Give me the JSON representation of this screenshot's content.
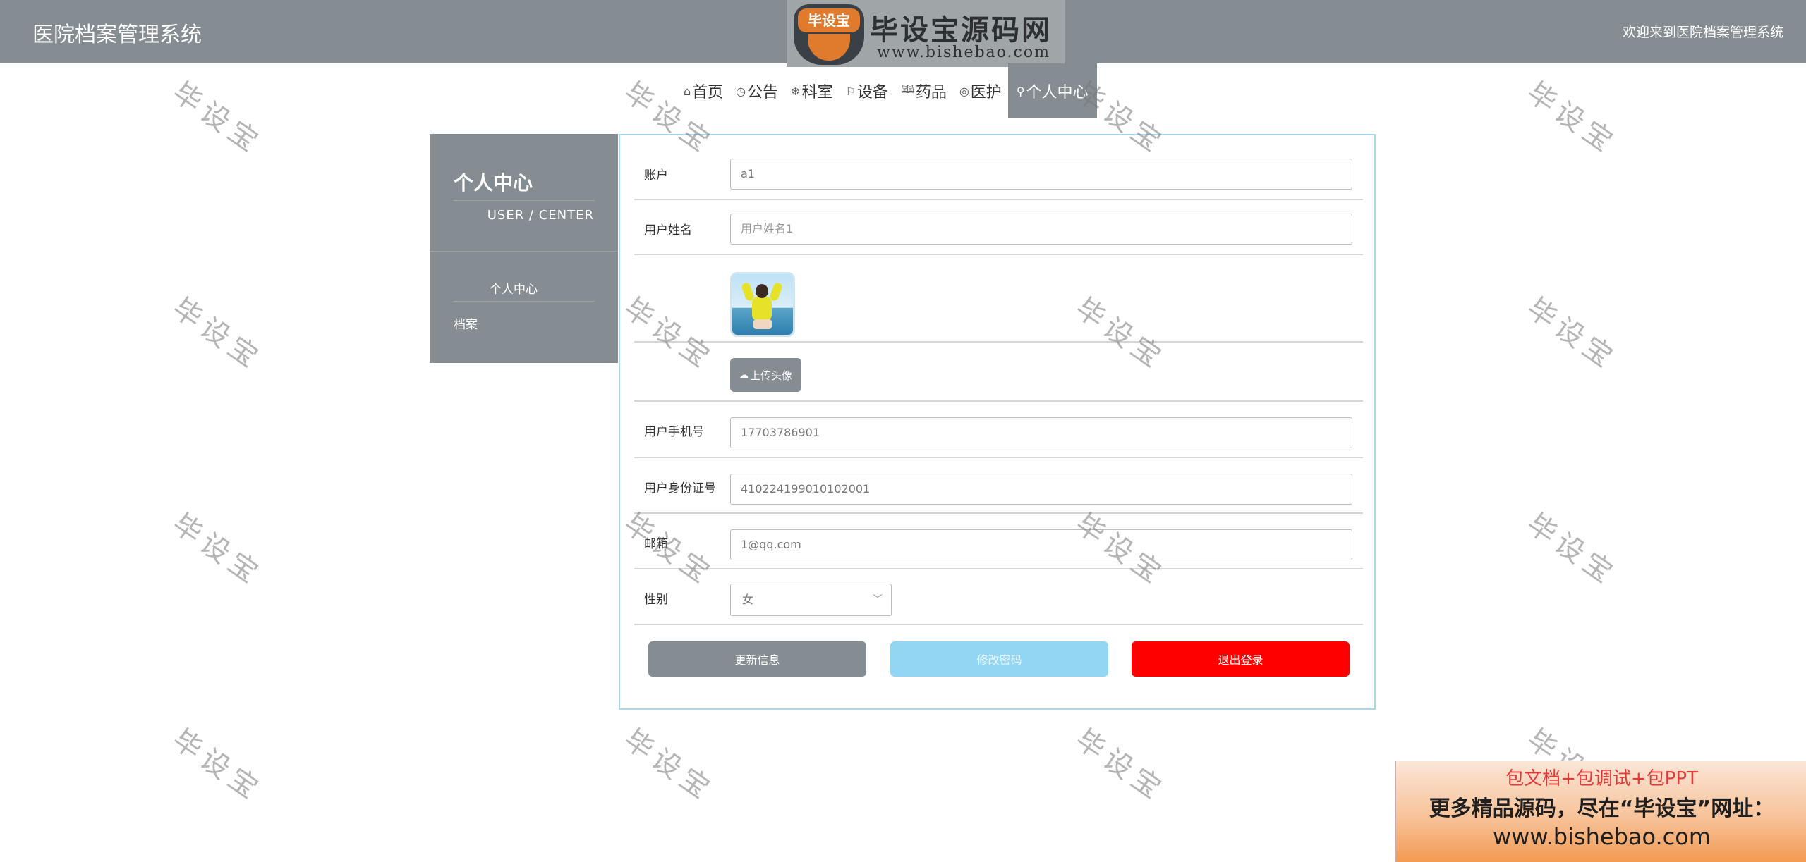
{
  "header": {
    "title": "医院档案管理系统",
    "welcome": "欢迎来到医院档案管理系统"
  },
  "logo": {
    "badge": "毕设宝",
    "name": "毕设宝源码网",
    "url": "www.bishebao.com"
  },
  "nav": {
    "items": [
      {
        "label": "首页",
        "icon": "home-icon",
        "glyph": "⌂"
      },
      {
        "label": "公告",
        "icon": "gauge-icon",
        "glyph": "◷"
      },
      {
        "label": "科室",
        "icon": "snowflake-icon",
        "glyph": "❄"
      },
      {
        "label": "设备",
        "icon": "flag-icon",
        "glyph": "⚐"
      },
      {
        "label": "药品",
        "icon": "book-icon",
        "glyph": "🕮"
      },
      {
        "label": "医护",
        "icon": "palette-icon",
        "glyph": "◎"
      },
      {
        "label": "个人中心",
        "icon": "user-icon",
        "glyph": "⚲",
        "active": true
      }
    ]
  },
  "sidebar": {
    "title": "个人中心",
    "subtitle": "USER / CENTER",
    "items": [
      {
        "label": "个人中心"
      },
      {
        "label": "档案"
      }
    ]
  },
  "form": {
    "account": {
      "label": "账户",
      "value": "a1"
    },
    "name": {
      "label": "用户姓名",
      "placeholder": "用户姓名1"
    },
    "upload_label": "上传头像",
    "phone": {
      "label": "用户手机号",
      "value": "17703786901"
    },
    "idcard": {
      "label": "用户身份证号",
      "value": "410224199010102001"
    },
    "email": {
      "label": "邮箱",
      "value": "1@qq.com"
    },
    "gender": {
      "label": "性别",
      "value": "女"
    }
  },
  "buttons": {
    "update": "更新信息",
    "change_password": "修改密码",
    "logout": "退出登录"
  },
  "colors": {
    "primary": "#858d92",
    "accent_light": "#93d6f3",
    "danger": "#ff0000",
    "panel_border": "#a7d8ec"
  },
  "watermark": "毕设宝",
  "ad": {
    "line1": "包文档+包调试+包PPT",
    "line2": "更多精品源码，尽在“毕设宝”网址：",
    "line3": "www.bishebao.com"
  }
}
